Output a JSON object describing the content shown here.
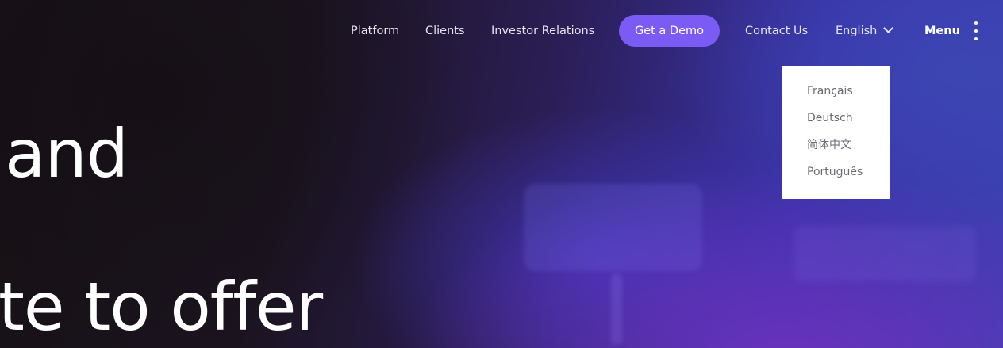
{
  "nav": {
    "links": [
      {
        "label": "Platform"
      },
      {
        "label": "Clients"
      },
      {
        "label": "Investor Relations"
      }
    ],
    "cta_label": "Get a Demo",
    "contact_label": "Contact Us",
    "language_label": "English",
    "menu_label": "Menu"
  },
  "language_dropdown": {
    "options": [
      "Français",
      "Deutsch",
      "简体中文",
      "Português"
    ]
  },
  "hero": {
    "line1": "and",
    "line2": "te to offer"
  },
  "colors": {
    "cta_background": "#7a5cf5",
    "dropdown_background": "#ffffff",
    "text_primary": "#ffffff"
  }
}
